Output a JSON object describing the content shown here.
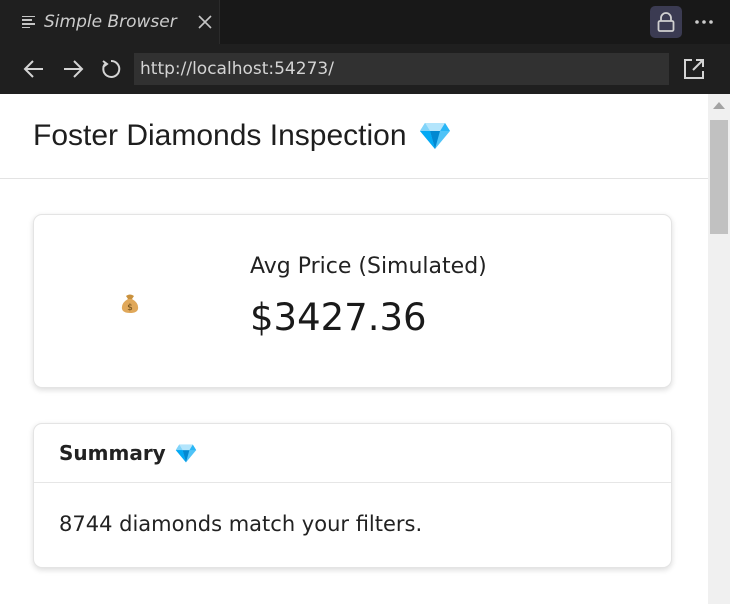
{
  "tab": {
    "title": "Simple Browser",
    "icon": "preview-icon",
    "close_icon": "close-icon"
  },
  "toolbar": {
    "lock_icon": "lock-icon",
    "more_icon": "more-icon",
    "accent_bg": "#3b3b52"
  },
  "nav": {
    "back_icon": "arrow-left-icon",
    "forward_icon": "arrow-right-icon",
    "reload_icon": "reload-icon",
    "url": "http://localhost:54273/",
    "open_external_icon": "open-external-icon"
  },
  "page": {
    "title": "Foster Diamonds Inspection",
    "title_icon": "gem-icon",
    "metric": {
      "icon": "money-bag-icon",
      "label": "Avg Price (Simulated)",
      "value": "$3427.36"
    },
    "summary": {
      "title": "Summary",
      "title_icon": "gem-icon",
      "text": "8744 diamonds match your filters."
    }
  },
  "scrollbar": {
    "position_fraction": 0.0
  }
}
